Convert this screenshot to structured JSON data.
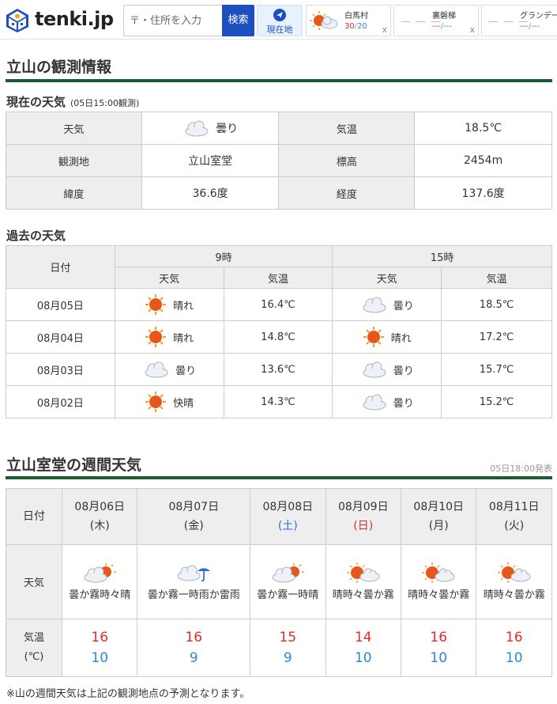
{
  "header": {
    "logo": "tenki.jp",
    "search_placeholder": "〒・住所を入力",
    "search_button": "検索",
    "location_button": "現在地",
    "favorites": [
      {
        "name": "白馬村",
        "high": "30",
        "low": "20",
        "icon": "sun-cloud-icon",
        "close": "x"
      },
      {
        "name": "裏磐梯",
        "high": "---",
        "low": "---",
        "icon": "none",
        "close": "x"
      },
      {
        "name": "グランデー",
        "high": "---",
        "low": "---",
        "icon": "none",
        "close": ""
      }
    ]
  },
  "obs": {
    "title": "立山の観測情報",
    "current_title": "現在の天気",
    "current_time": "(05日15:00観測)",
    "rows": [
      {
        "l1": "天気",
        "v1": "曇り",
        "l2": "気温",
        "v2": "18.5℃"
      },
      {
        "l1": "観測地",
        "v1": "立山室堂",
        "l2": "標高",
        "v2": "2454m"
      },
      {
        "l1": "緯度",
        "v1": "36.6度",
        "l2": "経度",
        "v2": "137.6度"
      }
    ]
  },
  "past": {
    "title": "過去の天気",
    "date_header": "日付",
    "time1": "9時",
    "time2": "15時",
    "weather_header": "天気",
    "temp_header": "気温",
    "rows": [
      {
        "date": "08月05日",
        "w1": "晴れ",
        "i1": "sun",
        "t1": "16.4℃",
        "w2": "曇り",
        "i2": "cloud",
        "t2": "18.5℃"
      },
      {
        "date": "08月04日",
        "w1": "晴れ",
        "i1": "sun",
        "t1": "14.8℃",
        "w2": "晴れ",
        "i2": "sun",
        "t2": "17.2℃"
      },
      {
        "date": "08月03日",
        "w1": "曇り",
        "i1": "cloud",
        "t1": "13.6℃",
        "w2": "曇り",
        "i2": "cloud",
        "t2": "15.7℃"
      },
      {
        "date": "08月02日",
        "w1": "快晴",
        "i1": "sun",
        "t1": "14.3℃",
        "w2": "曇り",
        "i2": "cloud",
        "t2": "15.2℃"
      }
    ]
  },
  "week": {
    "title": "立山室堂の週間天気",
    "issued": "05日18:00発表",
    "date_label": "日付",
    "weather_label": "天気",
    "temp_label": "気温",
    "temp_unit": "(℃)",
    "days": [
      {
        "date": "08月06日",
        "dow": "(木)",
        "dow_type": "",
        "weather": "曇か霧時々晴",
        "icon": "cloud-sun",
        "high": "16",
        "low": "10"
      },
      {
        "date": "08月07日",
        "dow": "(金)",
        "dow_type": "",
        "weather": "曇か霧一時雨か雷雨",
        "icon": "cloud-umbrella",
        "high": "16",
        "low": "9"
      },
      {
        "date": "08月08日",
        "dow": "(土)",
        "dow_type": "sat",
        "weather": "曇か霧一時晴",
        "icon": "cloud-sun",
        "high": "15",
        "low": "9"
      },
      {
        "date": "08月09日",
        "dow": "(日)",
        "dow_type": "sun",
        "weather": "晴時々曇か霧",
        "icon": "sun-cloud",
        "high": "14",
        "low": "10"
      },
      {
        "date": "08月10日",
        "dow": "(月)",
        "dow_type": "",
        "weather": "晴時々曇か霧",
        "icon": "sun-cloud",
        "high": "16",
        "low": "10"
      },
      {
        "date": "08月11日",
        "dow": "(火)",
        "dow_type": "",
        "weather": "晴時々曇か霧",
        "icon": "sun-cloud",
        "high": "16",
        "low": "10"
      }
    ],
    "note": "※山の週間天気は上記の観測地点の予測となります。"
  },
  "colors": {
    "accent": "#1f5a33",
    "search": "#1e4fc0",
    "high": "#e02c2c",
    "low": "#2a88d8"
  }
}
